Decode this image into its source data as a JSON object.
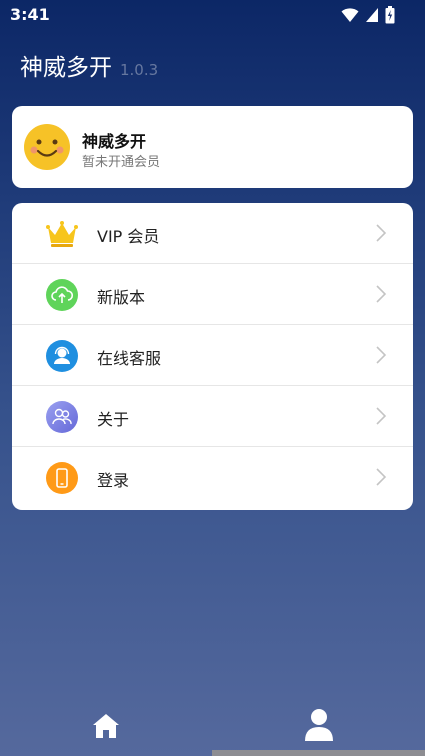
{
  "status_bar": {
    "time": "3:41",
    "icons": [
      "wifi-icon",
      "signal-icon",
      "battery-icon"
    ]
  },
  "header": {
    "app_name": "神威多开",
    "version": "1.0.3"
  },
  "profile": {
    "name": "神威多开",
    "status": "暂未开通会员",
    "avatar_icon": "smiley-face-icon"
  },
  "menu": {
    "items": [
      {
        "label": "VIP 会员",
        "icon": "crown-icon",
        "color": "#f5c518"
      },
      {
        "label": "新版本",
        "icon": "cloud-upload-icon",
        "color": "#5fd45a"
      },
      {
        "label": "在线客服",
        "icon": "customer-service-icon",
        "color": "#1f8fe0"
      },
      {
        "label": "关于",
        "icon": "about-users-icon",
        "color": "#7b7fe0"
      },
      {
        "label": "登录",
        "icon": "phone-login-icon",
        "color": "#ff9a17"
      }
    ]
  },
  "bottom_nav": {
    "tabs": [
      {
        "name": "home",
        "icon": "home-icon"
      },
      {
        "name": "profile",
        "icon": "person-icon",
        "active": true
      }
    ]
  }
}
